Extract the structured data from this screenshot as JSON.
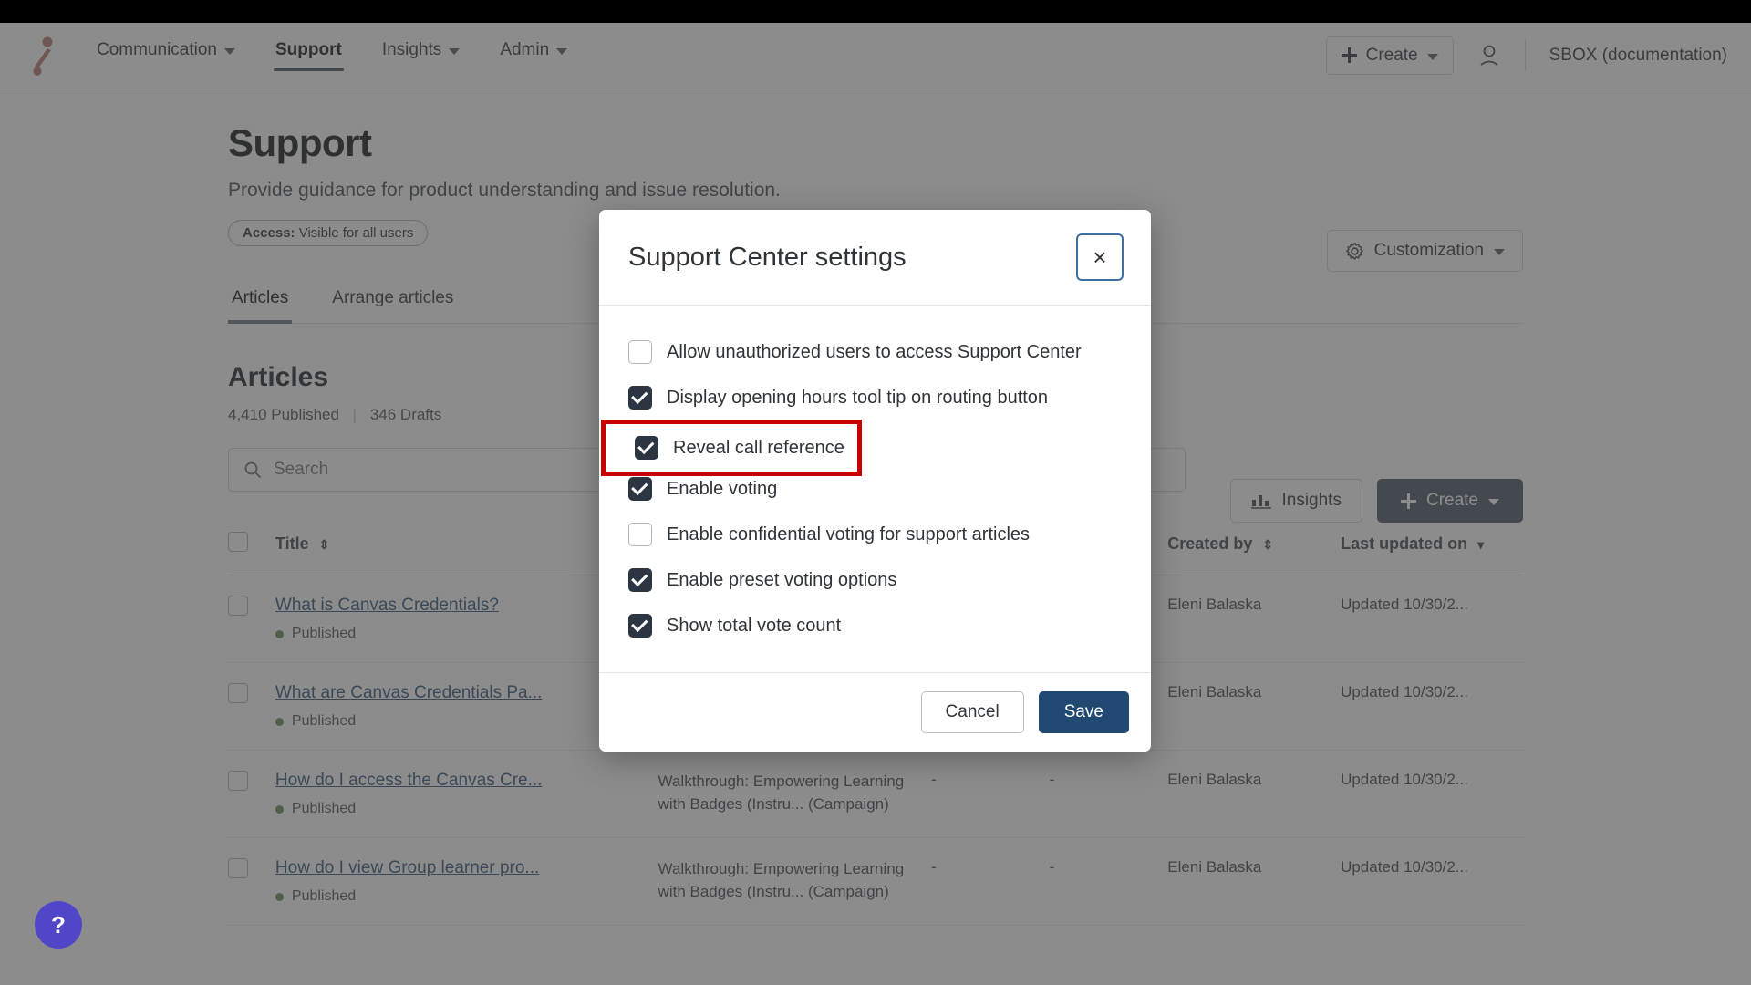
{
  "topnav": {
    "logo_icon": "brand-logo-icon",
    "items": [
      {
        "label": "Communication",
        "has_caret": true,
        "active": false
      },
      {
        "label": "Support",
        "has_caret": false,
        "active": true
      },
      {
        "label": "Insights",
        "has_caret": true,
        "active": false
      },
      {
        "label": "Admin",
        "has_caret": true,
        "active": false
      }
    ],
    "create_label": "Create",
    "account_icon": "person-icon",
    "org_name": "SBOX (documentation)"
  },
  "page": {
    "title": "Support",
    "subtitle": "Provide guidance for product understanding and issue resolution.",
    "access_label": "Access:",
    "access_value": "Visible for all users",
    "customization_label": "Customization",
    "customization_icon": "gear-icon"
  },
  "tabs": [
    {
      "label": "Articles",
      "active": true
    },
    {
      "label": "Arrange articles",
      "active": false
    }
  ],
  "articles_section": {
    "heading": "Articles",
    "published_count": "4,410 Published",
    "drafts_count": "346 Drafts",
    "search_placeholder": "Search",
    "search_value": "",
    "search_icon": "search-icon",
    "insights_label": "Insights",
    "insights_icon": "bar-chart-icon",
    "create_label": "Create"
  },
  "table": {
    "headers": {
      "title": "Title",
      "created_by": "Created by",
      "last_updated": "Last updated on"
    },
    "rows": [
      {
        "title": "What is Canvas Credentials?",
        "status": "Published",
        "campaign": "",
        "col_a": "",
        "col_b": "",
        "created_by": "Eleni Balaska",
        "last_updated": "Updated 10/30/2..."
      },
      {
        "title": "What are Canvas Credentials Pa...",
        "status": "Published",
        "campaign": "",
        "col_a": "",
        "col_b": "",
        "created_by": "Eleni Balaska",
        "last_updated": "Updated 10/30/2..."
      },
      {
        "title": "How do I access the Canvas Cre...",
        "status": "Published",
        "campaign": "Walkthrough: Empowering Learning with Badges (Instru... (Campaign)",
        "col_a": "-",
        "col_b": "-",
        "created_by": "Eleni Balaska",
        "last_updated": "Updated 10/30/2..."
      },
      {
        "title": "How do I view Group learner pro...",
        "status": "Published",
        "campaign": "Walkthrough: Empowering Learning with Badges (Instru... (Campaign)",
        "col_a": "-",
        "col_b": "-",
        "created_by": "Eleni Balaska",
        "last_updated": "Updated 10/30/2..."
      }
    ]
  },
  "help": {
    "icon_label": "?"
  },
  "modal": {
    "title": "Support Center settings",
    "close_label": "×",
    "options": [
      {
        "label": "Allow unauthorized users to access Support Center",
        "checked": false,
        "highlighted": false
      },
      {
        "label": "Display opening hours tool tip on routing button",
        "checked": true,
        "highlighted": false
      },
      {
        "label": "Reveal call reference",
        "checked": true,
        "highlighted": true
      },
      {
        "label": "Enable voting",
        "checked": true,
        "highlighted": false
      },
      {
        "label": "Enable confidential voting for support articles",
        "checked": false,
        "highlighted": false
      },
      {
        "label": "Enable preset voting options",
        "checked": true,
        "highlighted": false
      },
      {
        "label": "Show total vote count",
        "checked": true,
        "highlighted": false
      }
    ],
    "cancel_label": "Cancel",
    "save_label": "Save"
  },
  "colors": {
    "highlight_border": "#c90000",
    "save_button": "#204a72",
    "create_button": "#5e6b78",
    "status_dot": "#7a9b6e",
    "link": "#4b6b8a",
    "help_bubble": "#4f46c8"
  }
}
